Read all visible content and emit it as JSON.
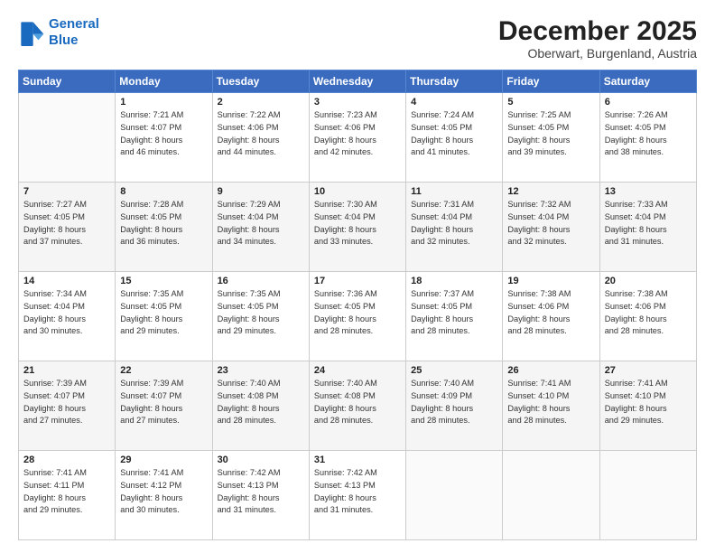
{
  "logo": {
    "line1": "General",
    "line2": "Blue"
  },
  "header": {
    "month": "December 2025",
    "location": "Oberwart, Burgenland, Austria"
  },
  "weekdays": [
    "Sunday",
    "Monday",
    "Tuesday",
    "Wednesday",
    "Thursday",
    "Friday",
    "Saturday"
  ],
  "weeks": [
    [
      {
        "day": "",
        "info": ""
      },
      {
        "day": "1",
        "info": "Sunrise: 7:21 AM\nSunset: 4:07 PM\nDaylight: 8 hours\nand 46 minutes."
      },
      {
        "day": "2",
        "info": "Sunrise: 7:22 AM\nSunset: 4:06 PM\nDaylight: 8 hours\nand 44 minutes."
      },
      {
        "day": "3",
        "info": "Sunrise: 7:23 AM\nSunset: 4:06 PM\nDaylight: 8 hours\nand 42 minutes."
      },
      {
        "day": "4",
        "info": "Sunrise: 7:24 AM\nSunset: 4:05 PM\nDaylight: 8 hours\nand 41 minutes."
      },
      {
        "day": "5",
        "info": "Sunrise: 7:25 AM\nSunset: 4:05 PM\nDaylight: 8 hours\nand 39 minutes."
      },
      {
        "day": "6",
        "info": "Sunrise: 7:26 AM\nSunset: 4:05 PM\nDaylight: 8 hours\nand 38 minutes."
      }
    ],
    [
      {
        "day": "7",
        "info": "Sunrise: 7:27 AM\nSunset: 4:05 PM\nDaylight: 8 hours\nand 37 minutes."
      },
      {
        "day": "8",
        "info": "Sunrise: 7:28 AM\nSunset: 4:05 PM\nDaylight: 8 hours\nand 36 minutes."
      },
      {
        "day": "9",
        "info": "Sunrise: 7:29 AM\nSunset: 4:04 PM\nDaylight: 8 hours\nand 34 minutes."
      },
      {
        "day": "10",
        "info": "Sunrise: 7:30 AM\nSunset: 4:04 PM\nDaylight: 8 hours\nand 33 minutes."
      },
      {
        "day": "11",
        "info": "Sunrise: 7:31 AM\nSunset: 4:04 PM\nDaylight: 8 hours\nand 32 minutes."
      },
      {
        "day": "12",
        "info": "Sunrise: 7:32 AM\nSunset: 4:04 PM\nDaylight: 8 hours\nand 32 minutes."
      },
      {
        "day": "13",
        "info": "Sunrise: 7:33 AM\nSunset: 4:04 PM\nDaylight: 8 hours\nand 31 minutes."
      }
    ],
    [
      {
        "day": "14",
        "info": "Sunrise: 7:34 AM\nSunset: 4:04 PM\nDaylight: 8 hours\nand 30 minutes."
      },
      {
        "day": "15",
        "info": "Sunrise: 7:35 AM\nSunset: 4:05 PM\nDaylight: 8 hours\nand 29 minutes."
      },
      {
        "day": "16",
        "info": "Sunrise: 7:35 AM\nSunset: 4:05 PM\nDaylight: 8 hours\nand 29 minutes."
      },
      {
        "day": "17",
        "info": "Sunrise: 7:36 AM\nSunset: 4:05 PM\nDaylight: 8 hours\nand 28 minutes."
      },
      {
        "day": "18",
        "info": "Sunrise: 7:37 AM\nSunset: 4:05 PM\nDaylight: 8 hours\nand 28 minutes."
      },
      {
        "day": "19",
        "info": "Sunrise: 7:38 AM\nSunset: 4:06 PM\nDaylight: 8 hours\nand 28 minutes."
      },
      {
        "day": "20",
        "info": "Sunrise: 7:38 AM\nSunset: 4:06 PM\nDaylight: 8 hours\nand 28 minutes."
      }
    ],
    [
      {
        "day": "21",
        "info": "Sunrise: 7:39 AM\nSunset: 4:07 PM\nDaylight: 8 hours\nand 27 minutes."
      },
      {
        "day": "22",
        "info": "Sunrise: 7:39 AM\nSunset: 4:07 PM\nDaylight: 8 hours\nand 27 minutes."
      },
      {
        "day": "23",
        "info": "Sunrise: 7:40 AM\nSunset: 4:08 PM\nDaylight: 8 hours\nand 28 minutes."
      },
      {
        "day": "24",
        "info": "Sunrise: 7:40 AM\nSunset: 4:08 PM\nDaylight: 8 hours\nand 28 minutes."
      },
      {
        "day": "25",
        "info": "Sunrise: 7:40 AM\nSunset: 4:09 PM\nDaylight: 8 hours\nand 28 minutes."
      },
      {
        "day": "26",
        "info": "Sunrise: 7:41 AM\nSunset: 4:10 PM\nDaylight: 8 hours\nand 28 minutes."
      },
      {
        "day": "27",
        "info": "Sunrise: 7:41 AM\nSunset: 4:10 PM\nDaylight: 8 hours\nand 29 minutes."
      }
    ],
    [
      {
        "day": "28",
        "info": "Sunrise: 7:41 AM\nSunset: 4:11 PM\nDaylight: 8 hours\nand 29 minutes."
      },
      {
        "day": "29",
        "info": "Sunrise: 7:41 AM\nSunset: 4:12 PM\nDaylight: 8 hours\nand 30 minutes."
      },
      {
        "day": "30",
        "info": "Sunrise: 7:42 AM\nSunset: 4:13 PM\nDaylight: 8 hours\nand 31 minutes."
      },
      {
        "day": "31",
        "info": "Sunrise: 7:42 AM\nSunset: 4:13 PM\nDaylight: 8 hours\nand 31 minutes."
      },
      {
        "day": "",
        "info": ""
      },
      {
        "day": "",
        "info": ""
      },
      {
        "day": "",
        "info": ""
      }
    ]
  ]
}
